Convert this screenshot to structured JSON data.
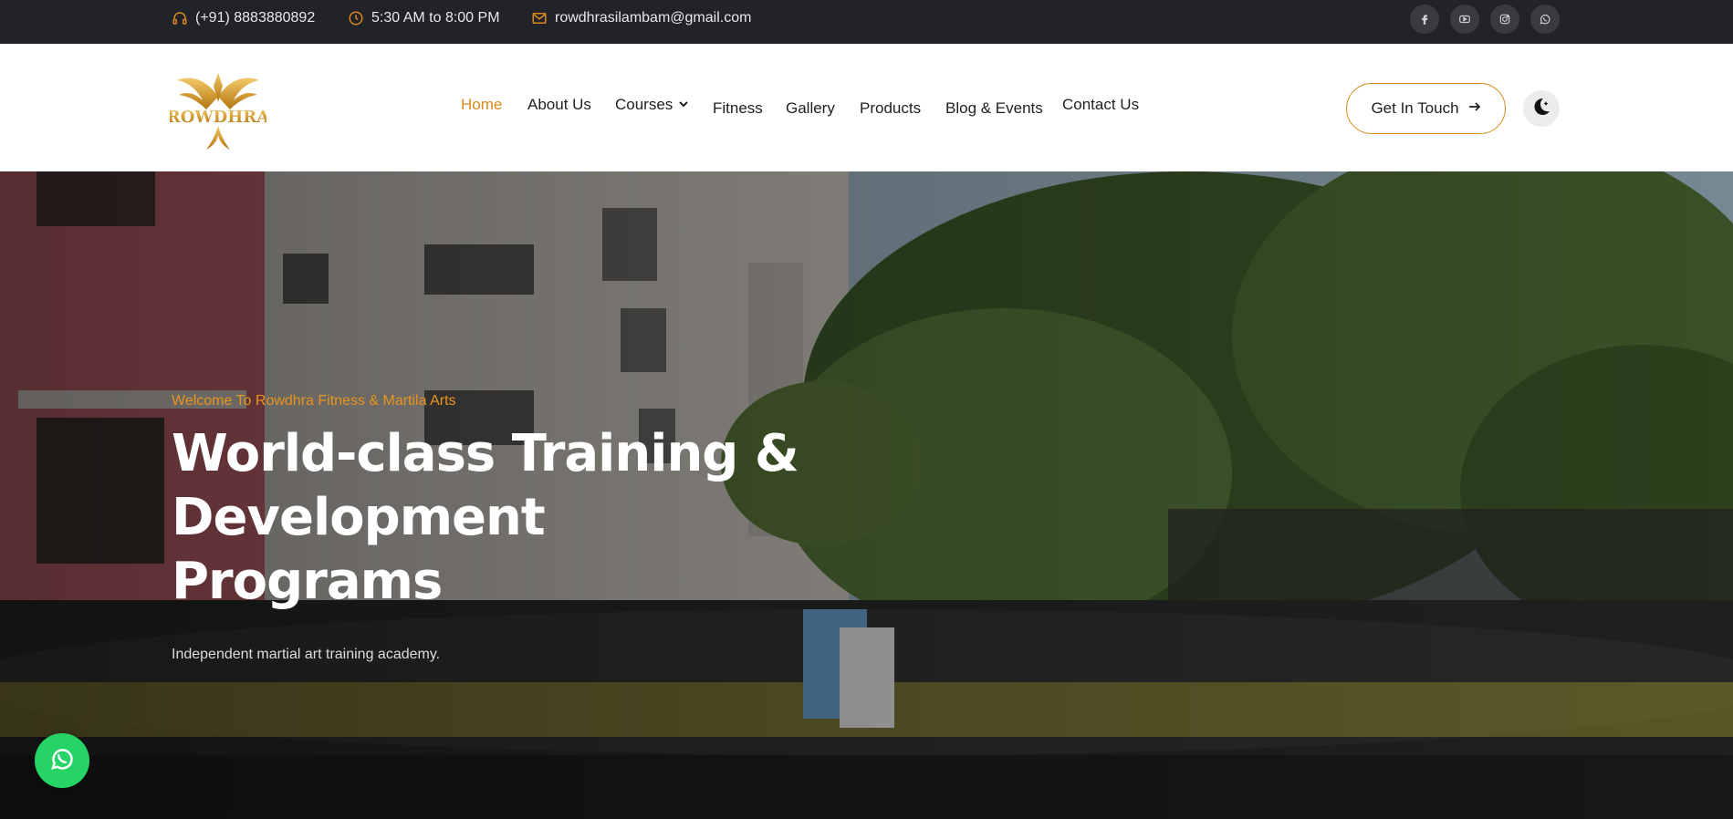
{
  "topbar": {
    "phone": "(+91) 8883880892",
    "hours": "5:30 AM to 8:00 PM",
    "email": "rowdhrasilambam@gmail.com",
    "socials": [
      "facebook-icon",
      "youtube-icon",
      "instagram-icon",
      "whatsapp-icon"
    ]
  },
  "header": {
    "logo_text": "ROWDHRA",
    "nav": [
      {
        "label": "Home",
        "active": true
      },
      {
        "label": "About Us"
      },
      {
        "label": "Courses",
        "has_dropdown": true
      },
      {
        "label": "Fitness"
      },
      {
        "label": "Gallery"
      },
      {
        "label": "Products"
      },
      {
        "label": "Blog & Events"
      },
      {
        "label": "Contact Us"
      }
    ],
    "cta_label": "Get In Touch"
  },
  "hero": {
    "kicker": "Welcome To Rowdhra Fitness & Martila Arts",
    "title_line1": "World-class Training &",
    "title_line2": "Development",
    "title_line3": "Programs",
    "subtitle": "Independent martial art training academy."
  },
  "colors": {
    "accent": "#d9891c",
    "topbar_bg": "#222328",
    "whatsapp": "#25d366"
  }
}
